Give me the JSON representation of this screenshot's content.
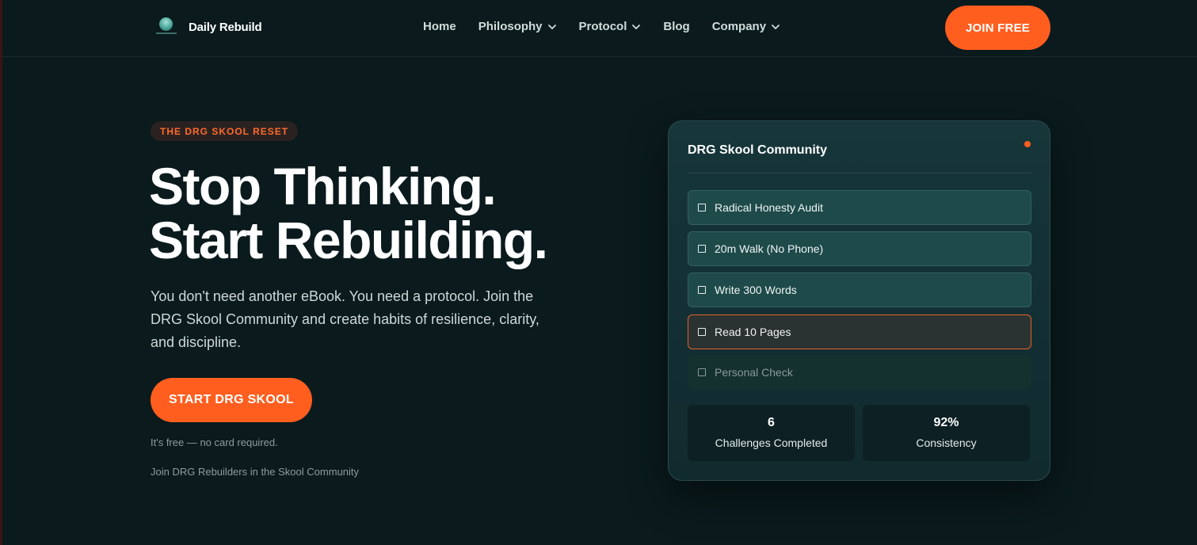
{
  "header": {
    "brand": "Daily Rebuild",
    "nav": [
      {
        "label": "Home",
        "dropdown": false
      },
      {
        "label": "Philosophy",
        "dropdown": true
      },
      {
        "label": "Protocol",
        "dropdown": true
      },
      {
        "label": "Blog",
        "dropdown": false
      },
      {
        "label": "Company",
        "dropdown": true
      }
    ],
    "join_label": "JOIN FREE"
  },
  "hero": {
    "badge": "THE DRG SKOOL RESET",
    "headline_line1": "Stop Thinking.",
    "headline_line2": "Start Rebuilding.",
    "subtext": "You don't need another eBook. You need a protocol. Join the DRG Skool Community and create habits of resilience, clarity, and discipline.",
    "cta_label": "START DRG SKOOL",
    "note": "It's free — no card required.",
    "note2": "Join DRG Rebuilders in the Skool Community"
  },
  "card": {
    "title": "DRG Skool Community",
    "tasks": [
      {
        "label": "Radical Honesty Audit",
        "state": "default"
      },
      {
        "label": "20m Walk (No Phone)",
        "state": "default"
      },
      {
        "label": "Write 300 Words",
        "state": "default"
      },
      {
        "label": "Read 10 Pages",
        "state": "active"
      },
      {
        "label": "Personal Check",
        "state": "faded"
      }
    ],
    "stats": [
      {
        "value": "6",
        "label": "Challenges Completed"
      },
      {
        "value": "92%",
        "label": "Consistency"
      }
    ]
  },
  "colors": {
    "background": "#0a1a1d",
    "accent": "#ff5e1f",
    "card_bg": "#16363a",
    "task_bg": "#1e4a4a"
  },
  "icons": {
    "logo": "wave-disc-logo-icon",
    "dropdown": "chevron-down-icon",
    "task": "checkbox-icon",
    "status": "status-dot-icon"
  }
}
